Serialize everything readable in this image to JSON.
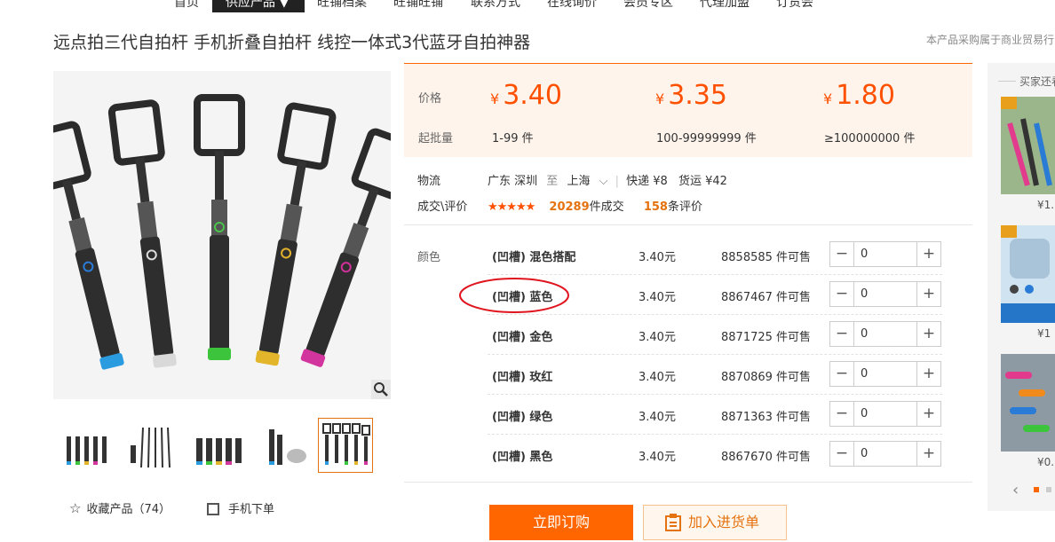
{
  "nav": {
    "items": [
      "首页",
      "供应产品 ▼",
      "旺铺档案",
      "旺铺旺铺",
      "联系方式",
      "在线询价",
      "会员专区",
      "代理加盟",
      "订货会"
    ]
  },
  "product": {
    "title": "远点拍三代自拍杆 手机折叠自拍杆 线控一体式3代蓝牙自拍神器",
    "notice": "本产品采购属于商业贸易行"
  },
  "prices": {
    "label_price": "价格",
    "label_moq": "起批量",
    "currency": "¥",
    "tiers": [
      {
        "price": "3.40",
        "qty": "1-99 件"
      },
      {
        "price": "3.35",
        "qty": "100-99999999 件"
      },
      {
        "price": "1.80",
        "qty": "≥100000000 件"
      }
    ]
  },
  "logistics": {
    "label": "物流",
    "from": "广东 深圳",
    "to_word": "至",
    "to": "上海",
    "express": "快递 ¥8",
    "freight": "货运 ¥42"
  },
  "deals": {
    "label": "成交\\评价",
    "stars": "★★★★★",
    "sold_count": "20289",
    "sold_text": "件成交",
    "review_count": "158",
    "review_text": "条评价"
  },
  "sku": {
    "label": "颜色",
    "rows": [
      {
        "name": "(凹槽) 混色搭配",
        "price": "3.40元",
        "stock": "8858585 件可售",
        "qty": "0"
      },
      {
        "name": "(凹槽) 蓝色",
        "price": "3.40元",
        "stock": "8867467 件可售",
        "qty": "0"
      },
      {
        "name": "(凹槽) 金色",
        "price": "3.40元",
        "stock": "8871725 件可售",
        "qty": "0"
      },
      {
        "name": "(凹槽) 玫红",
        "price": "3.40元",
        "stock": "8870869 件可售",
        "qty": "0"
      },
      {
        "name": "(凹槽) 绿色",
        "price": "3.40元",
        "stock": "8871363 件可售",
        "qty": "0"
      },
      {
        "name": "(凹槽) 黑色",
        "price": "3.40元",
        "stock": "8867670 件可售",
        "qty": "0"
      }
    ]
  },
  "actions": {
    "favorite": "收藏产品（74）",
    "mobile_order": "手机下单",
    "buy_now": "立即订购",
    "add_to_list": "加入进货单"
  },
  "sidebar": {
    "heading": "买家还看",
    "prices": [
      "¥1.",
      "¥1",
      "¥0."
    ]
  },
  "colors": {
    "accent": "#ff6600",
    "price": "#ff5000"
  }
}
